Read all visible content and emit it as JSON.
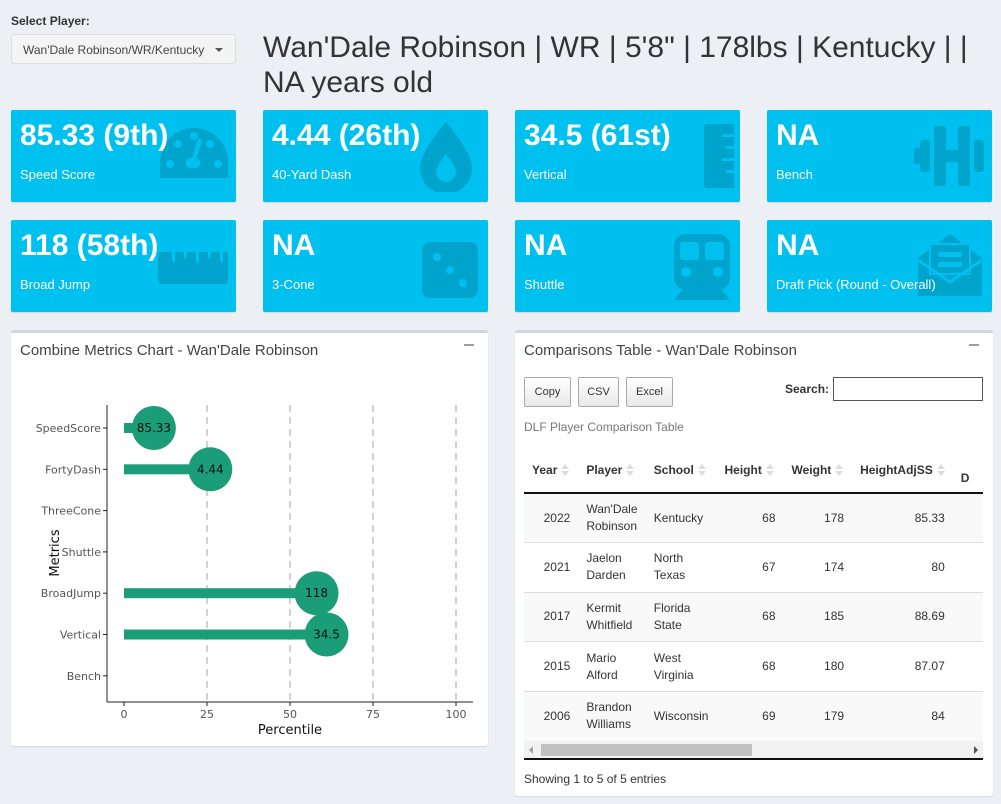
{
  "select_player": {
    "label": "Select Player:",
    "value": "Wan'Dale Robinson/WR/Kentucky"
  },
  "header": {
    "title": "Wan'Dale Robinson | WR | 5'8\" | 178lbs | Kentucky | | NA years old"
  },
  "value_boxes": [
    {
      "value": "85.33 (9th)",
      "label": "Speed Score",
      "icon": "tachometer-icon"
    },
    {
      "value": "4.44 (26th)",
      "label": "40-Yard Dash",
      "icon": "tint-drop-icon"
    },
    {
      "value": "34.5 (61st)",
      "label": "Vertical",
      "icon": "ruler-vertical-icon"
    },
    {
      "value": "NA",
      "label": "Bench",
      "icon": "dumbbell-icon"
    },
    {
      "value": "118 (58th)",
      "label": "Broad Jump",
      "icon": "ruler-horizontal-icon"
    },
    {
      "value": "NA",
      "label": "3-Cone",
      "icon": "dice-three-icon"
    },
    {
      "value": "NA",
      "label": "Shuttle",
      "icon": "subway-train-icon"
    },
    {
      "value": "NA",
      "label": "Draft Pick (Round - Overall)",
      "icon": "envelope-open-text-icon"
    }
  ],
  "chart_panel": {
    "title": "Combine Metrics Chart - Wan'Dale Robinson"
  },
  "chart_data": {
    "type": "lollipop",
    "title": "",
    "xlabel": "Percentile",
    "ylabel": "Metrics",
    "xlim": [
      0,
      100
    ],
    "xticks": [
      0,
      25,
      50,
      75,
      100
    ],
    "grid": "vertical dashed at x ticks",
    "categories": [
      "SpeedScore",
      "FortyDash",
      "ThreeCone",
      "Shuttle",
      "BroadJump",
      "Vertical",
      "Bench"
    ],
    "percentiles": [
      9,
      26,
      null,
      null,
      58,
      61,
      null
    ],
    "labels": [
      "85.33",
      "4.44",
      null,
      null,
      "118",
      "34.5",
      null
    ],
    "color": "#1b9e77"
  },
  "table_panel": {
    "title": "Comparisons Table - Wan'Dale Robinson",
    "buttons": [
      "Copy",
      "CSV",
      "Excel"
    ],
    "search_label": "Search:",
    "search_value": "",
    "caption": "DLF Player Comparison Table",
    "columns": [
      "Year",
      "Player",
      "School",
      "Height",
      "Weight",
      "HeightAdjSS",
      "D"
    ],
    "rows": [
      [
        "2022",
        "Wan'Dale Robinson",
        "Kentucky",
        "68",
        "178",
        "85.33"
      ],
      [
        "2021",
        "Jaelon Darden",
        "North Texas",
        "67",
        "174",
        "80"
      ],
      [
        "2017",
        "Kermit Whitfield",
        "Florida State",
        "68",
        "185",
        "88.69"
      ],
      [
        "2015",
        "Mario Alford",
        "West Virginia",
        "68",
        "180",
        "87.07"
      ],
      [
        "2006",
        "Brandon Williams",
        "Wisconsin",
        "69",
        "179",
        "84"
      ]
    ],
    "info": "Showing 1 to 5 of 5 entries"
  },
  "colors": {
    "value_box_bg": "#00c0ef",
    "value_box_icon": "#00a3cb",
    "lollipop": "#1b9e77",
    "page_bg": "#ecf0f5"
  }
}
